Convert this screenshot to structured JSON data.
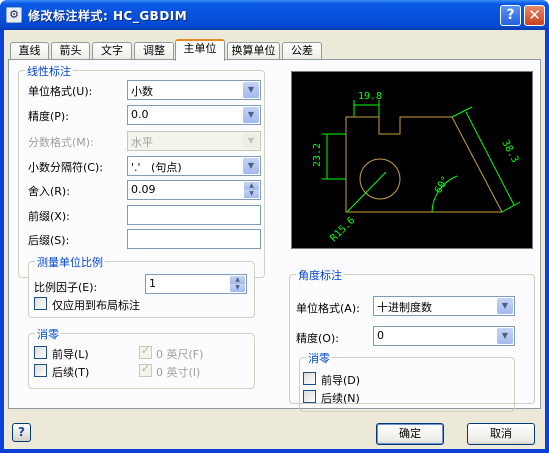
{
  "window": {
    "title": "修改标注样式: HC_GBDIM",
    "help_btn": "?",
    "close_btn": "✕"
  },
  "tabs": [
    {
      "label": "直线",
      "active": false
    },
    {
      "label": "箭头",
      "active": false
    },
    {
      "label": "文字",
      "active": false
    },
    {
      "label": "调整",
      "active": false
    },
    {
      "label": "主单位",
      "active": true
    },
    {
      "label": "换算单位",
      "active": false
    },
    {
      "label": "公差",
      "active": false
    }
  ],
  "linear": {
    "title": "线性标注",
    "unit_format_label": "单位格式(U):",
    "unit_format_value": "小数",
    "precision_label": "精度(P):",
    "precision_value": "0.0",
    "fraction_format_label": "分数格式(M):",
    "fraction_format_value": "水平",
    "decimal_sep_label": "小数分隔符(C):",
    "decimal_sep_value": "'.'   (句点)",
    "round_off_label": "舍入(R):",
    "round_off_value": "0.09",
    "prefix_label": "前缀(X):",
    "prefix_value": "",
    "suffix_label": "后缀(S):",
    "suffix_value": ""
  },
  "scale": {
    "title": "测量单位比例",
    "factor_label": "比例因子(E):",
    "factor_value": "1",
    "layout_only_label": "仅应用到布局标注",
    "layout_only_checked": false
  },
  "zero_linear": {
    "title": "消零",
    "leading_label": "前导(L)",
    "leading_checked": false,
    "trailing_label": "后续(T)",
    "trailing_checked": false,
    "feet_label": "0 英尺(F)",
    "feet_checked": true,
    "inches_label": "0 英寸(I)",
    "inches_checked": true
  },
  "angular": {
    "title": "角度标注",
    "unit_format_label": "单位格式(A):",
    "unit_format_value": "十进制度数",
    "precision_label": "精度(O):",
    "precision_value": "0"
  },
  "zero_angular": {
    "title": "消零",
    "leading_label": "前导(D)",
    "leading_checked": false,
    "trailing_label": "后续(N)",
    "trailing_checked": false
  },
  "preview": {
    "dim_top": "19.8",
    "dim_left": "23.2",
    "dim_right": "38.3",
    "dim_angle": "60°",
    "dim_radius": "R15.6",
    "line_color": "#00ff00",
    "part_color": "#c8a040",
    "text_color": "#00ff00"
  },
  "buttons": {
    "ok": "确定",
    "cancel": "取消",
    "help": "?"
  }
}
